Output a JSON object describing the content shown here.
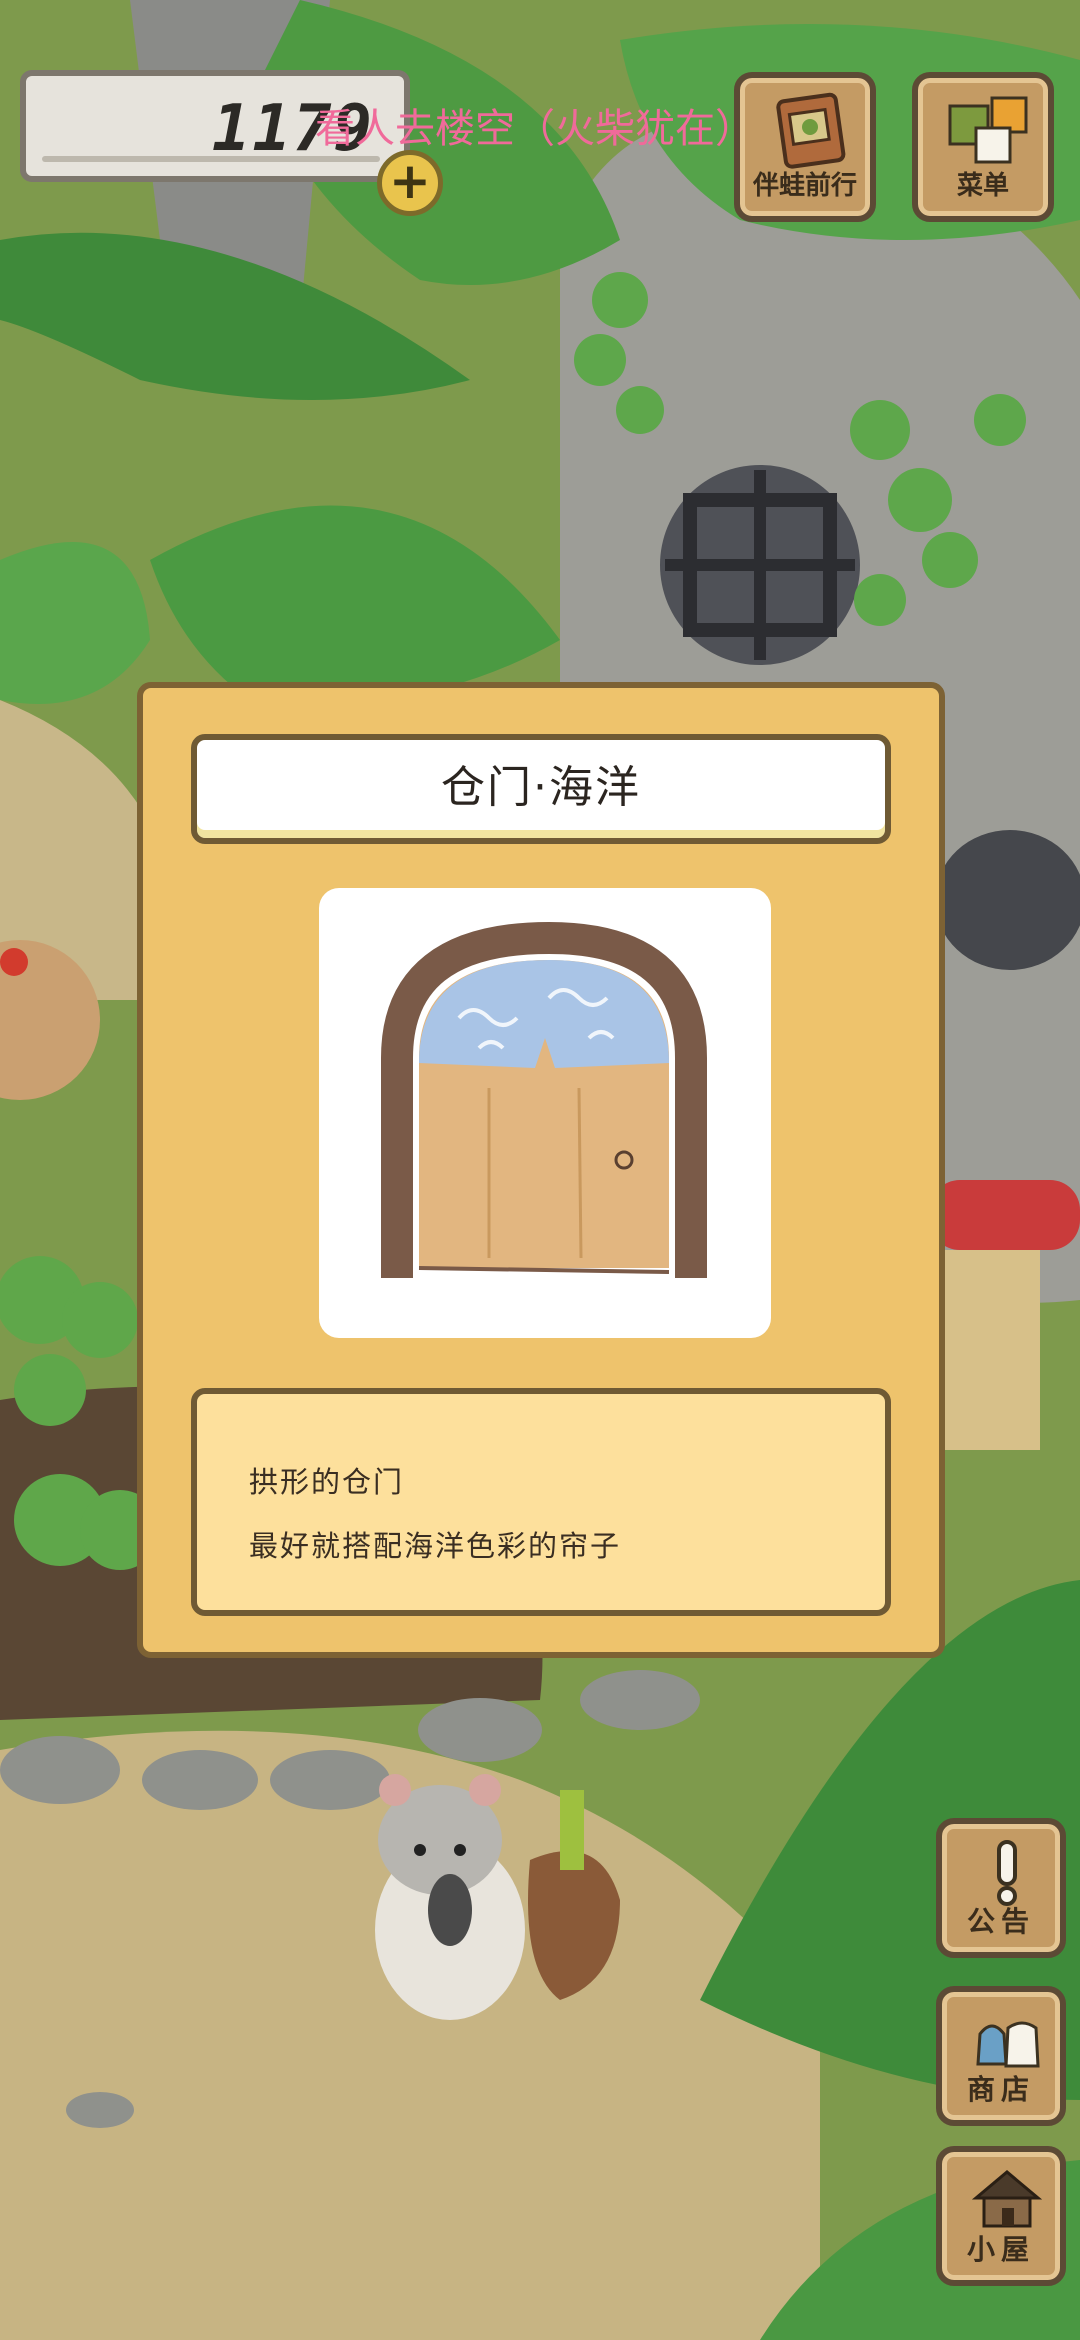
{
  "currency": {
    "amount": "1179",
    "add_symbol": "+"
  },
  "overlay": {
    "text": "看人去楼空（火柴犹在）"
  },
  "top_buttons": {
    "travel_companion_label": "伴蛙前行",
    "menu_label": "菜单"
  },
  "side_buttons": {
    "notice_label": "公告",
    "shop_label": "商店",
    "hut_label": "小屋"
  },
  "dialog": {
    "title": "仓门·海洋",
    "description_lines": [
      "拱形的仓门",
      "最好就搭配海洋色彩的帘子"
    ]
  },
  "colors": {
    "dialog_bg": "#eec36c",
    "desc_bg": "#fde09c",
    "button_bg": "#c49b64",
    "overlay_text": "#f06a9a",
    "coin": "#e9c44d"
  },
  "icons": {
    "travel_companion": "photo-album-icon",
    "menu": "menu-tiles-icon",
    "notice": "exclamation-icon",
    "shop": "shop-bags-icon",
    "hut": "hut-icon",
    "add": "plus-icon",
    "item": "arched-door-icon"
  }
}
